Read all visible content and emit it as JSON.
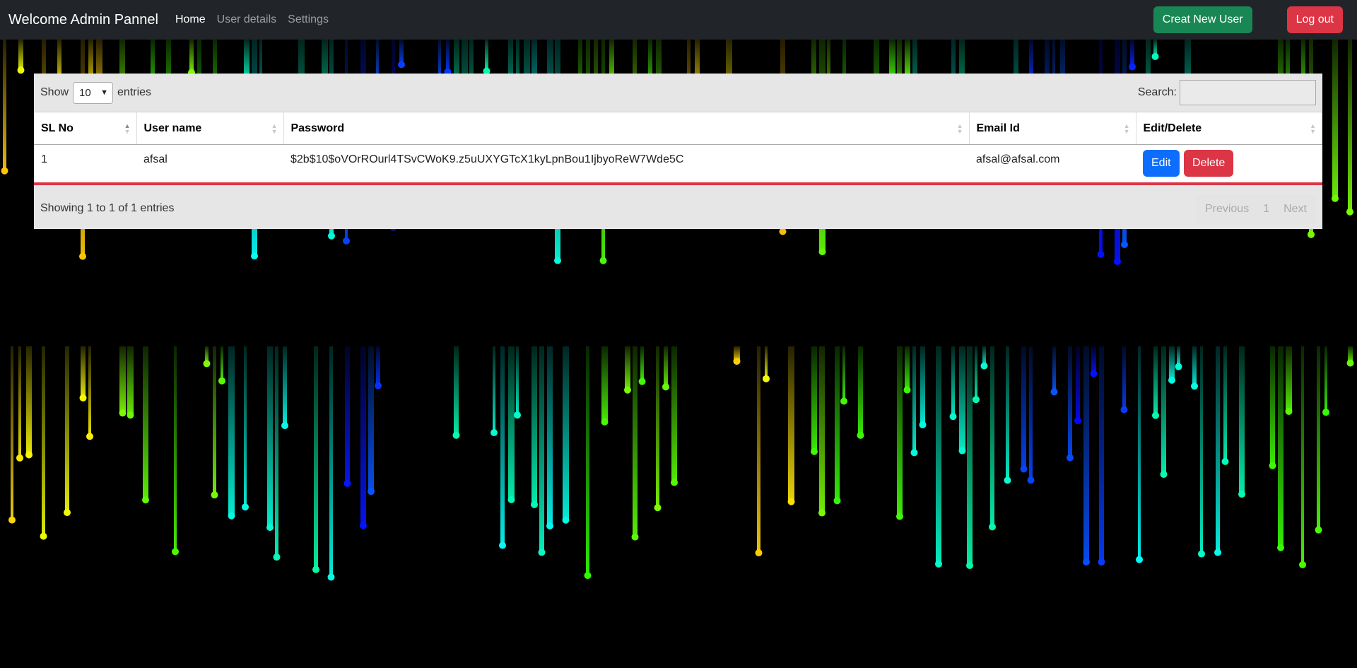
{
  "navbar": {
    "brand": "Welcome Admin Pannel",
    "links": [
      "Home",
      "User details",
      "Settings"
    ],
    "create_button": "Creat New User",
    "logout_button": "Log out"
  },
  "table_controls": {
    "show_label": "Show",
    "entries_value": "10",
    "entries_label": "entries",
    "search_label": "Search:",
    "search_value": ""
  },
  "table": {
    "columns": [
      "SL No",
      "User name",
      "Password",
      "Email Id",
      "Edit/Delete"
    ],
    "rows": [
      {
        "sl": "1",
        "username": "afsal",
        "password": "$2b$10$oVOrROurl4TSvCWoK9.z5uUXYGTcX1kyLpnBou1IjbyoReW7Wde5C",
        "email": "afsal@afsal.com",
        "edit_label": "Edit",
        "delete_label": "Delete"
      }
    ]
  },
  "footer": {
    "info": "Showing 1 to 1 of 1 entries",
    "previous": "Previous",
    "page": "1",
    "next": "Next"
  },
  "colors": {
    "navbar_bg": "#212529",
    "create_btn": "#198754",
    "logout_btn": "#dc3545",
    "edit_btn": "#0d6efd",
    "delete_btn": "#dc3545",
    "row_border": "#dc3545"
  }
}
